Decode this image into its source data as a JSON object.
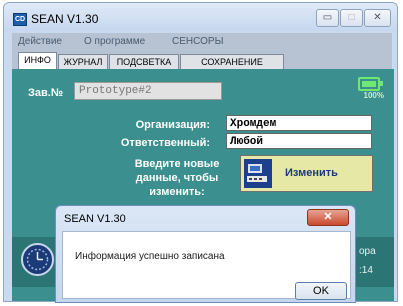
{
  "window": {
    "app_icon_text": "CD",
    "title": "SEAN V1.30",
    "controls": {
      "minimize": "▭",
      "maximize": "□",
      "close": "✕"
    }
  },
  "menu": [
    "Действие",
    "О программе",
    "СЕНСОРЫ"
  ],
  "tabs": [
    {
      "label": "ИНФО",
      "active": true
    },
    {
      "label": "ЖУРНАЛ",
      "active": false
    },
    {
      "label": "ПОДСВЕТКА",
      "active": false
    },
    {
      "label": "СОХРАНЕНИЕ ДАННЫХ",
      "active": false
    }
  ],
  "info": {
    "serial_label": "Зав.№",
    "serial_value": "Prototype#2",
    "battery_percent": "100%",
    "battery_level": 1.0,
    "org_label": "Организация:",
    "org_value": "Хромдем",
    "resp_label": "Ответственный:",
    "resp_value": "Любой",
    "hint": "Введите новые данные, чтобы изменить:",
    "change_button": "Изменить"
  },
  "background_fragments": {
    "line1": "ора",
    "line2": ":14"
  },
  "dialog": {
    "title": "SEAN V1.30",
    "close": "✕",
    "message": "Информация успешно записана",
    "ok": "OK"
  },
  "colors": {
    "panel": "#3b8f8f",
    "change_button_bg": "#e6e8a6",
    "battery": "#6ee86e"
  },
  "icons": [
    "app-icon",
    "battery-icon",
    "change-data-icon",
    "clock-icon",
    "close-icon"
  ]
}
